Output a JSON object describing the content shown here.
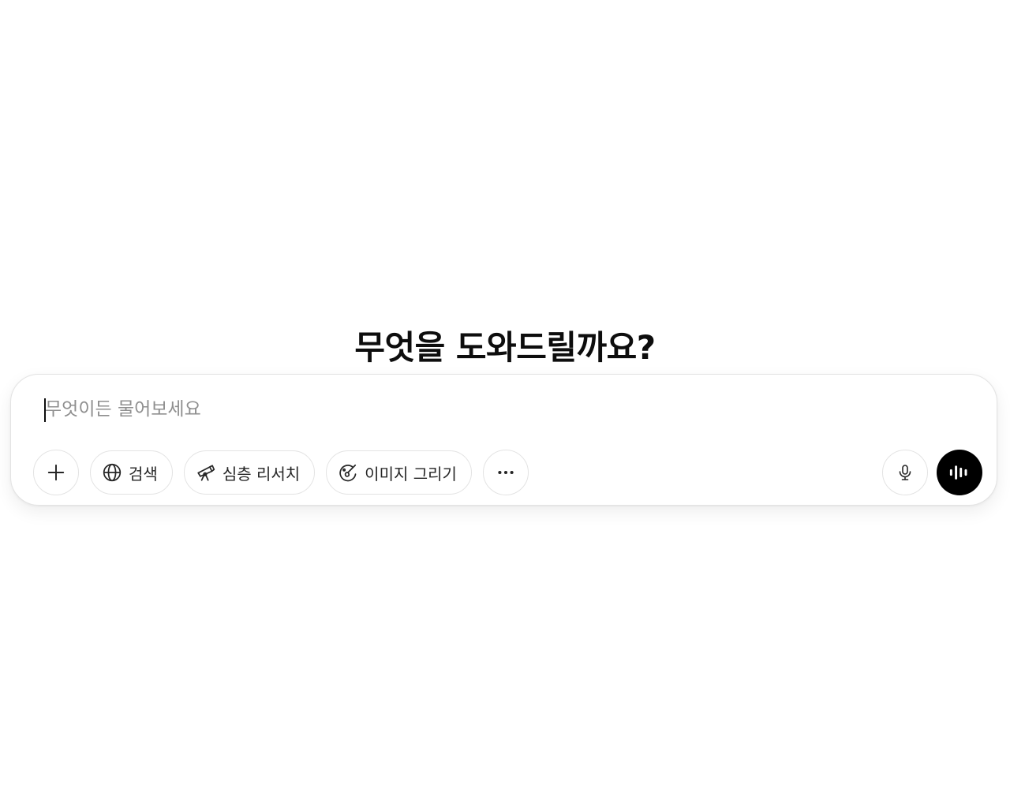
{
  "heading": "무엇을 도와드릴까요?",
  "composer": {
    "placeholder": "무엇이든 물어보세요",
    "value": ""
  },
  "toolbar": {
    "add_icon": "plus-icon",
    "search_label": "검색",
    "search_icon": "globe-icon",
    "research_label": "심층 리서치",
    "research_icon": "telescope-icon",
    "image_label": "이미지 그리기",
    "image_icon": "paint-brush-icon",
    "more_icon": "ellipsis-icon",
    "mic_icon": "microphone-icon",
    "voice_icon": "voice-waveform-icon"
  },
  "colors": {
    "text": "#0d0d0d",
    "placeholder": "#8f8f8f",
    "border": "#e3e3e3",
    "voice_button": "#000000"
  }
}
